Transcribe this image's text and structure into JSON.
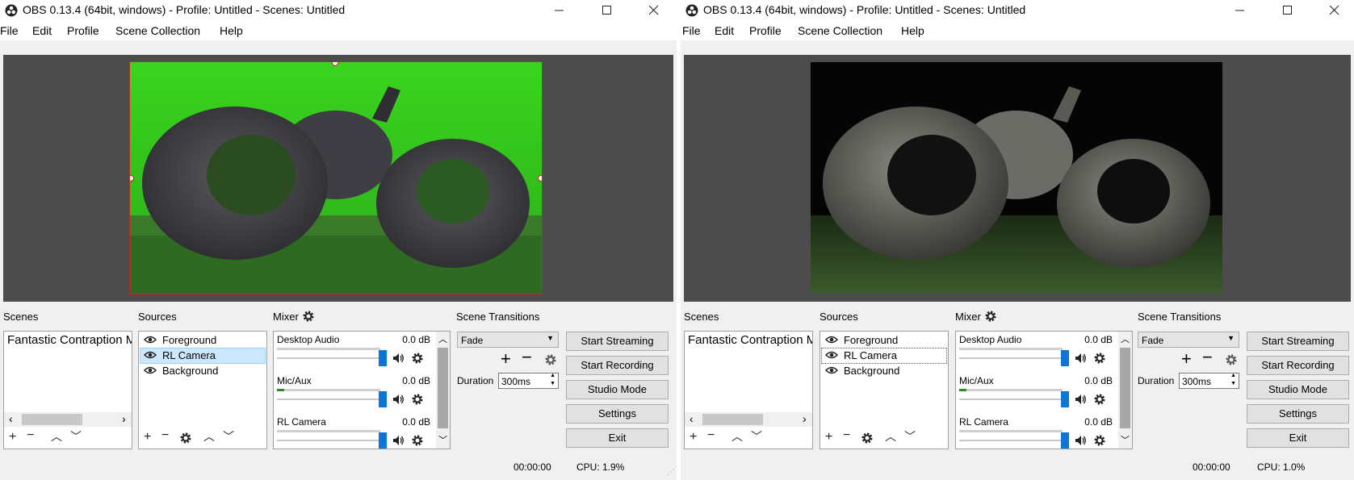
{
  "windows": [
    {
      "title": "OBS 0.13.4 (64bit, windows) - Profile: Untitled - Scenes: Untitled",
      "menu": [
        "File",
        "Edit",
        "Profile",
        "Scene Collection",
        "Help"
      ],
      "sections": {
        "scenes": "Scenes",
        "sources": "Sources",
        "mixer": "Mixer",
        "transitions": "Scene Transitions"
      },
      "scenes": [
        "Fantastic Contraption M"
      ],
      "sources": [
        {
          "name": "Foreground",
          "selected": false
        },
        {
          "name": "RL Camera",
          "selected": true
        },
        {
          "name": "Background",
          "selected": false
        }
      ],
      "mixer": [
        {
          "name": "Desktop Audio",
          "db": "0.0 dB",
          "level": 1.0,
          "vu": 0
        },
        {
          "name": "Mic/Aux",
          "db": "0.0 dB",
          "level": 1.0,
          "vu": 0.07
        },
        {
          "name": "RL Camera",
          "db": "0.0 dB",
          "level": 1.0,
          "vu": 0
        }
      ],
      "transition": {
        "selected": "Fade",
        "duration_label": "Duration",
        "duration_value": "300ms"
      },
      "buttons": {
        "start_streaming": "Start Streaming",
        "start_recording": "Start Recording",
        "studio_mode": "Studio Mode",
        "settings": "Settings",
        "exit": "Exit"
      },
      "status": {
        "time": "00:00:00",
        "cpu": "CPU: 1.9%"
      },
      "preview": {
        "background": "green",
        "selection_color": "#cc2222",
        "selected_source": true
      }
    },
    {
      "title": "OBS 0.13.4 (64bit, windows) - Profile: Untitled - Scenes: Untitled",
      "menu": [
        "File",
        "Edit",
        "Profile",
        "Scene Collection",
        "Help"
      ],
      "sections": {
        "scenes": "Scenes",
        "sources": "Sources",
        "mixer": "Mixer",
        "transitions": "Scene Transitions"
      },
      "scenes": [
        "Fantastic Contraption M"
      ],
      "sources": [
        {
          "name": "Foreground",
          "selected": false
        },
        {
          "name": "RL Camera",
          "selected": false
        },
        {
          "name": "Background",
          "selected": false
        }
      ],
      "mixer": [
        {
          "name": "Desktop Audio",
          "db": "0.0 dB",
          "level": 1.0,
          "vu": 0
        },
        {
          "name": "Mic/Aux",
          "db": "0.0 dB",
          "level": 1.0,
          "vu": 0.07
        },
        {
          "name": "RL Camera",
          "db": "0.0 dB",
          "level": 1.0,
          "vu": 0
        }
      ],
      "transition": {
        "selected": "Fade",
        "duration_label": "Duration",
        "duration_value": "300ms"
      },
      "buttons": {
        "start_streaming": "Start Streaming",
        "start_recording": "Start Recording",
        "studio_mode": "Studio Mode",
        "settings": "Settings",
        "exit": "Exit"
      },
      "status": {
        "time": "00:00:00",
        "cpu": "CPU: 1.0%"
      },
      "preview": {
        "background": "black",
        "selection_color": "",
        "selected_source": false
      }
    }
  ],
  "colors": {
    "accent": "#0b76d8",
    "selection_bg": "#cce8ff",
    "selection_border": "#99d1ff",
    "preview_bg": "#4c4c4c"
  },
  "icons": [
    "obs-logo-icon",
    "minimize-icon",
    "maximize-icon",
    "close-icon",
    "gear-icon",
    "eye-icon",
    "speaker-icon",
    "plus-icon",
    "minus-icon",
    "chevron-up-icon",
    "chevron-down-icon"
  ]
}
